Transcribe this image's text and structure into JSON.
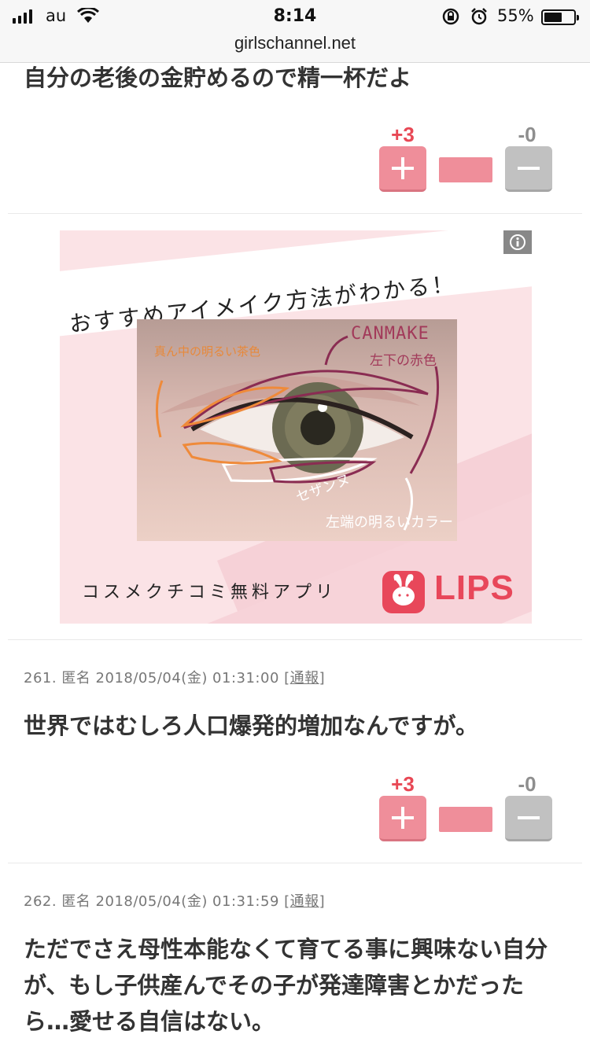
{
  "status_bar": {
    "carrier": "au",
    "time": "8:14",
    "battery_percent": "55%",
    "battery_level": 0.55,
    "url": "girlschannel.net"
  },
  "comments": [
    {
      "text": "自分の老後の金貯めるので精一杯だよ",
      "plus_count": "+3",
      "minus_count": "-0"
    },
    {
      "number": "261.",
      "author": "匿名",
      "datetime": "2018/05/04(金) 01:31:00",
      "report_open": "[",
      "report": "通報",
      "report_close": "]",
      "text": "世界ではむしろ人口爆発的増加なんですが。",
      "plus_count": "+3",
      "minus_count": "-0"
    },
    {
      "number": "262.",
      "author": "匿名",
      "datetime": "2018/05/04(金) 01:31:59",
      "report_open": "[",
      "report": "通報",
      "report_close": "]",
      "text_lines": [
        "ただでさえ母性本能なくて育てる事に興味ない自分",
        "が、もし子供産んでその子が発達障害とかだった",
        "ら…愛せる自信はない。"
      ]
    }
  ],
  "ad": {
    "headline": "おすすめアイメイク方法がわかる！",
    "annotation_canmake": "CANMAKE",
    "annotation_red": "左下の赤色",
    "annotation_tea": "真ん中の明るい茶色",
    "annotation_sezanne": "セザンヌ",
    "annotation_bright": "左端の明るいカラー",
    "tagline": "コスメクチコミ無料アプリ",
    "brand": "LIPS",
    "brand_color": "#e8475a"
  },
  "colors": {
    "plus": "#e84855",
    "plus_button": "#ef8e9a",
    "minus_button": "#c1c1c1"
  }
}
